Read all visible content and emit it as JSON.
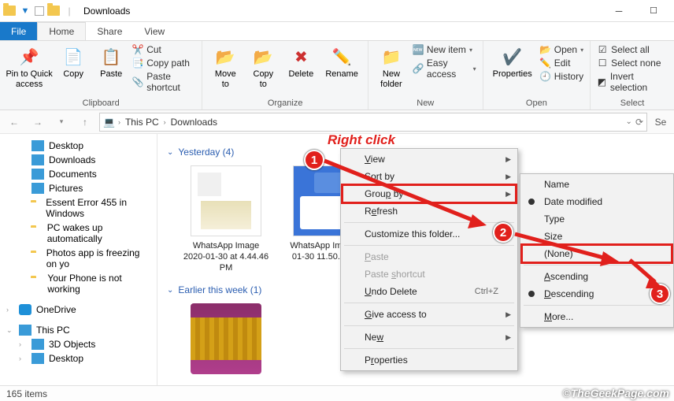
{
  "titlebar": {
    "title": "Downloads"
  },
  "tabs": {
    "file": "File",
    "home": "Home",
    "share": "Share",
    "view": "View"
  },
  "ribbon": {
    "clipboard": {
      "label": "Clipboard",
      "pin": "Pin to Quick\naccess",
      "copy": "Copy",
      "paste": "Paste",
      "cut": "Cut",
      "copypath": "Copy path",
      "pasteshortcut": "Paste shortcut"
    },
    "organize": {
      "label": "Organize",
      "moveto": "Move\nto",
      "copyto": "Copy\nto",
      "delete": "Delete",
      "rename": "Rename"
    },
    "new": {
      "label": "New",
      "newfolder": "New\nfolder",
      "newitem": "New item",
      "easyaccess": "Easy access"
    },
    "open": {
      "label": "Open",
      "properties": "Properties",
      "open": "Open",
      "edit": "Edit",
      "history": "History"
    },
    "select": {
      "label": "Select",
      "all": "Select all",
      "none": "Select none",
      "invert": "Invert selection"
    }
  },
  "breadcrumb": {
    "thispc": "This PC",
    "downloads": "Downloads"
  },
  "search_placeholder": "Se",
  "tree": {
    "desktop": "Desktop",
    "downloads": "Downloads",
    "documents": "Documents",
    "pictures": "Pictures",
    "f1": "Essent Error 455 in Windows",
    "f2": "PC wakes up automatically",
    "f3": "Photos app is freezing on yo",
    "f4": "Your Phone is not working",
    "onedrive": "OneDrive",
    "thispc": "This PC",
    "obj3d": "3D Objects",
    "desktop2": "Desktop"
  },
  "groups": {
    "yesterday": "Yesterday (4)",
    "earlier": "Earlier this week (1)"
  },
  "files": {
    "f1": "WhatsApp Image 2020-01-30 at 4.44.46 PM",
    "f2": "WhatsApp Im 2020-01-30 11.50.26 AM"
  },
  "ctx": {
    "view": "View",
    "sortby": "Sort by",
    "groupby": "Group by",
    "refresh": "Refresh",
    "customize": "Customize this folder...",
    "paste": "Paste",
    "pasteshortcut": "Paste shortcut",
    "undodelete": "Undo Delete",
    "undokey": "Ctrl+Z",
    "giveaccess": "Give access to",
    "new": "New",
    "properties": "Properties"
  },
  "subctx": {
    "name": "Name",
    "datemod": "Date modified",
    "type": "Type",
    "size": "Size",
    "none": "(None)",
    "asc": "Ascending",
    "desc": "Descending",
    "more": "More..."
  },
  "anno": {
    "rightclick": "Right click",
    "b1": "1",
    "b2": "2",
    "b3": "3"
  },
  "status": {
    "items": "165 items"
  },
  "watermark": "©TheGeekPage.com"
}
